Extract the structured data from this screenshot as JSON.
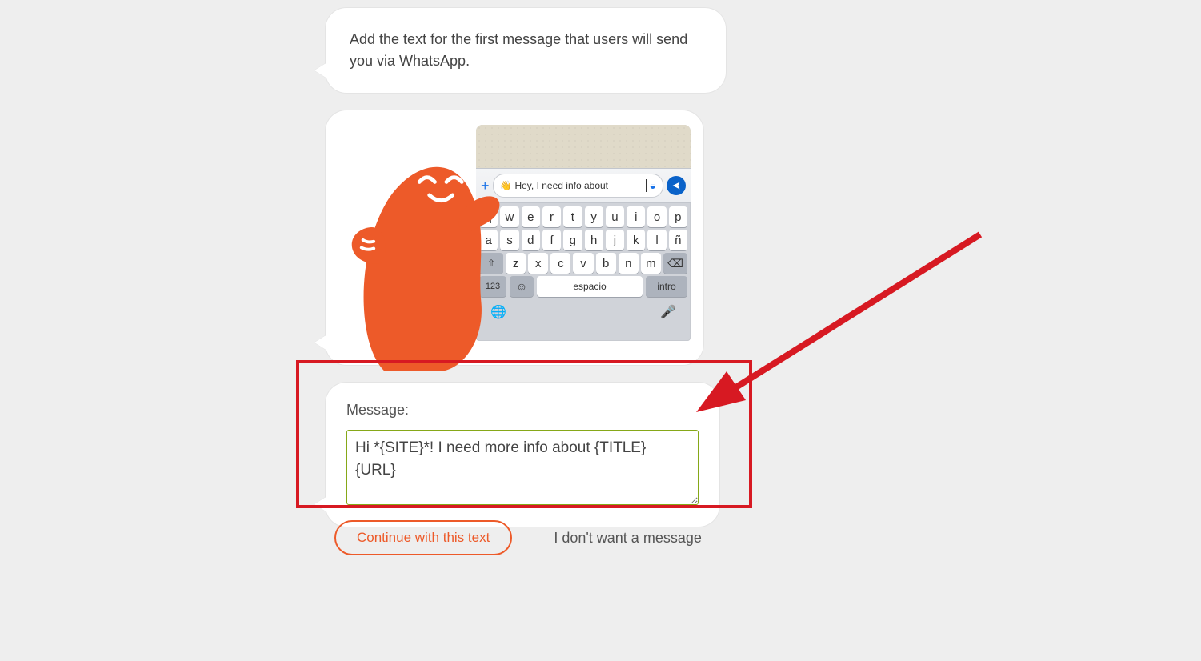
{
  "instruction_bubble": {
    "text": "Add the text for the first message that users will send you via WhatsApp."
  },
  "phone_mock": {
    "input_text": "Hey, I need info about",
    "keyboard": {
      "row1": [
        "q",
        "w",
        "e",
        "r",
        "t",
        "y",
        "u",
        "i",
        "o",
        "p"
      ],
      "row2": [
        "a",
        "s",
        "d",
        "f",
        "g",
        "h",
        "j",
        "k",
        "l",
        "ñ"
      ],
      "row3": [
        "z",
        "x",
        "c",
        "v",
        "b",
        "n",
        "m"
      ],
      "num_key": "123",
      "space_key": "espacio",
      "enter_key": "intro"
    }
  },
  "message_form": {
    "label": "Message:",
    "value": "Hi *{SITE}*! I need more info about {TITLE} {URL}"
  },
  "actions": {
    "continue_label": "Continue with this text",
    "skip_label": "I don't want a message"
  },
  "colors": {
    "accent": "#ed5a29",
    "annotation": "#d71922",
    "focus_border": "#86a818"
  }
}
